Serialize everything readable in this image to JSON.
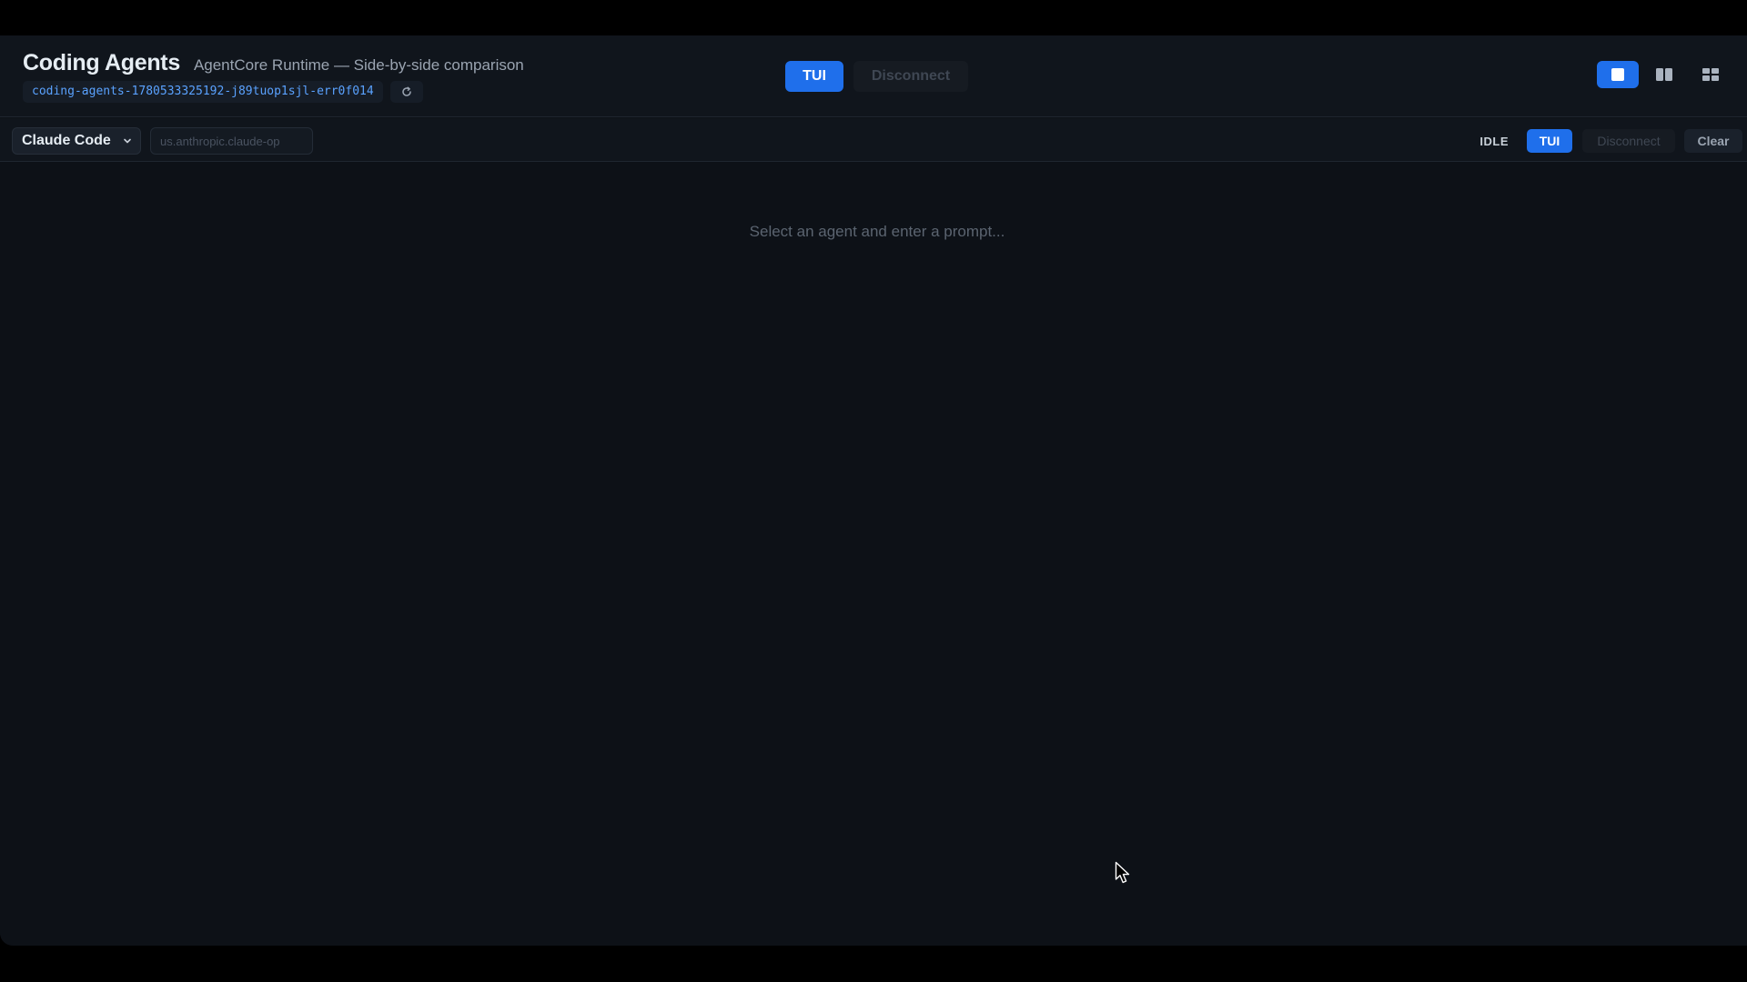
{
  "header": {
    "title": "Coding Agents",
    "subtitle": "AgentCore Runtime — Side-by-side comparison",
    "session_id": "coding-agents-1780533325192-j89tuop1sjl-err0f014",
    "refresh_icon": "refresh-icon",
    "tui_label": "TUI",
    "disconnect_label": "Disconnect",
    "layout_options": [
      "single-pane-icon",
      "two-column-icon",
      "grid-icon"
    ],
    "active_layout": "single-pane-icon"
  },
  "panel": {
    "agent_selected": "Claude Code",
    "model_placeholder": "us.anthropic.claude-op",
    "status": "IDLE",
    "tui_label": "TUI",
    "disconnect_label": "Disconnect",
    "clear_label": "Clear",
    "empty_message": "Select an agent and enter a prompt..."
  },
  "colors": {
    "accent": "#1f6feb",
    "background": "#0d1117",
    "session_id_text": "#5aa2ff"
  }
}
